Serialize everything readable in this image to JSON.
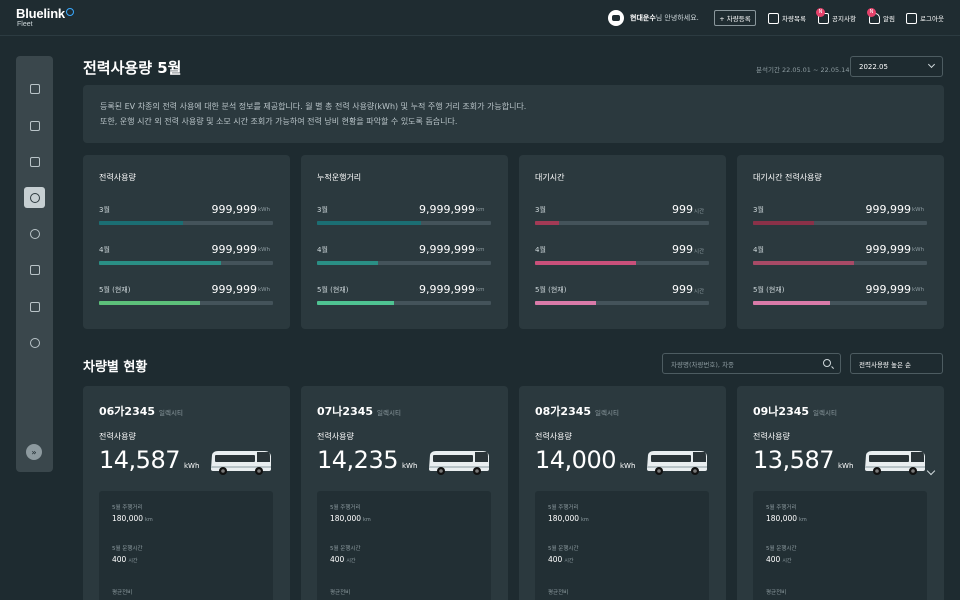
{
  "header": {
    "logo": "Bluelink",
    "logo_sub": "Fleet",
    "company": "현대운수",
    "greeting": "님 안녕하세요.",
    "register_button": "+ 차량등록",
    "nav": [
      {
        "label": "차량목록",
        "icon": "clipboard-icon",
        "badge": ""
      },
      {
        "label": "공지사항",
        "icon": "megaphone-icon",
        "badge": "N"
      },
      {
        "label": "알림",
        "icon": "bell-icon",
        "badge": "N"
      },
      {
        "label": "로그아웃",
        "icon": "logout-icon",
        "badge": ""
      }
    ]
  },
  "sidebar": {
    "items": [
      {
        "icon": "dashboard-icon",
        "active": false
      },
      {
        "icon": "bus-icon",
        "active": false
      },
      {
        "icon": "building-icon",
        "active": false
      },
      {
        "icon": "leaf-icon",
        "active": true
      },
      {
        "icon": "tree-icon",
        "active": false
      },
      {
        "icon": "document-icon",
        "active": false
      },
      {
        "icon": "download-icon",
        "active": false
      },
      {
        "icon": "settings-icon",
        "active": false
      }
    ],
    "collapse_label": "»"
  },
  "page": {
    "title": "전력사용량 5월",
    "period": "분석기간 22.05.01 ~ 22.05.14",
    "month_select": "2022.05",
    "description_1": "등록된 EV 차종의 전력 사용에 대한 분석 정보를 제공합니다. 월 별 총 전력 사용량(kWh) 및 누적 주행 거리 조회가 가능합니다.",
    "description_2": "또한, 운행 시간 외 전력 사용량 및 소모 시간 조회가 가능하여 전력 낭비 현황을 파악할 수 있도록 돕습니다."
  },
  "stats": [
    {
      "title": "전력사용량",
      "rows": [
        {
          "label": "3월",
          "value": "999,999",
          "unit": "kWh",
          "fill": 0.48,
          "color": "#1b6e73"
        },
        {
          "label": "4월",
          "value": "999,999",
          "unit": "kWh",
          "fill": 0.7,
          "color": "#2a8f85"
        },
        {
          "label": "5월 (현재)",
          "value": "999,999",
          "unit": "kWh",
          "fill": 0.58,
          "color": "#5dc07a"
        }
      ]
    },
    {
      "title": "누적운행거리",
      "rows": [
        {
          "label": "3월",
          "value": "9,999,999",
          "unit": "km",
          "fill": 0.6,
          "color": "#1b6e73"
        },
        {
          "label": "4월",
          "value": "9,999,999",
          "unit": "km",
          "fill": 0.35,
          "color": "#2a8f85"
        },
        {
          "label": "5월 (현재)",
          "value": "9,999,999",
          "unit": "km",
          "fill": 0.44,
          "color": "#4fc392"
        }
      ]
    },
    {
      "title": "대기시간",
      "rows": [
        {
          "label": "3월",
          "value": "999",
          "unit": "시간",
          "fill": 0.14,
          "color": "#a33a55"
        },
        {
          "label": "4월",
          "value": "999",
          "unit": "시간",
          "fill": 0.58,
          "color": "#c9507a"
        },
        {
          "label": "5월 (현재)",
          "value": "999",
          "unit": "시간",
          "fill": 0.35,
          "color": "#d97aa8"
        }
      ]
    },
    {
      "title": "대기시간 전력사용량",
      "rows": [
        {
          "label": "3월",
          "value": "999,999",
          "unit": "kWh",
          "fill": 0.35,
          "color": "#8a3148"
        },
        {
          "label": "4월",
          "value": "999,999",
          "unit": "kWh",
          "fill": 0.58,
          "color": "#a84a66"
        },
        {
          "label": "5월 (현재)",
          "value": "999,999",
          "unit": "kWh",
          "fill": 0.44,
          "color": "#d97aa8"
        }
      ]
    }
  ],
  "vehicles_section": {
    "title": "차량별 현황",
    "search_placeholder": "차량명(차량번호), 차종",
    "sort_label": "전력사용량 높은 순"
  },
  "vehicles": [
    {
      "plate": "06가2345",
      "model": "일렉시티",
      "label": "전력사용량",
      "usage": "14,587",
      "unit": "kWh",
      "d_label": "5월 주행거리",
      "d_value": "180,000",
      "d_unit": "km",
      "t_label": "5월 운행시간",
      "t_value": "400",
      "t_unit": "시간",
      "e_label": "평균전비"
    },
    {
      "plate": "07나2345",
      "model": "일렉시티",
      "label": "전력사용량",
      "usage": "14,235",
      "unit": "kWh",
      "d_label": "5월 주행거리",
      "d_value": "180,000",
      "d_unit": "km",
      "t_label": "5월 운행시간",
      "t_value": "400",
      "t_unit": "시간",
      "e_label": "평균전비"
    },
    {
      "plate": "08가2345",
      "model": "일렉시티",
      "label": "전력사용량",
      "usage": "14,000",
      "unit": "kWh",
      "d_label": "5월 주행거리",
      "d_value": "180,000",
      "d_unit": "km",
      "t_label": "5월 운행시간",
      "t_value": "400",
      "t_unit": "시간",
      "e_label": "평균전비"
    },
    {
      "plate": "09나2345",
      "model": "일렉시티",
      "label": "전력사용량",
      "usage": "13,587",
      "unit": "kWh",
      "d_label": "5월 주행거리",
      "d_value": "180,000",
      "d_unit": "km",
      "t_label": "5월 운행시간",
      "t_value": "400",
      "t_unit": "시간",
      "e_label": "평균전비"
    }
  ]
}
